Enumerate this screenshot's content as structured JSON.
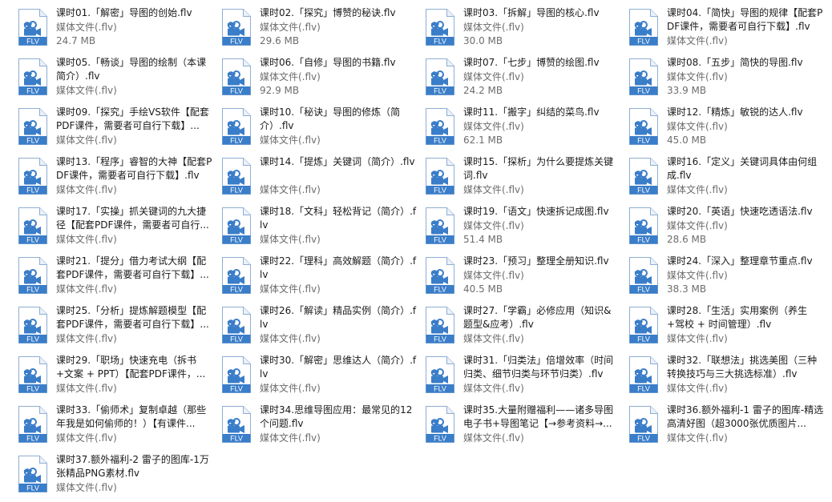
{
  "file_type_label": "媒体文件(.flv)",
  "icon_badge": "FLV",
  "icon_name": "video-camera-icon",
  "colors": {
    "icon_blue": "#3a7dc9",
    "icon_blue_dark": "#245f9e",
    "text": "#1a1a1a",
    "meta_text": "#6d6d6d"
  },
  "files": [
    {
      "name": "课时01.「解密」导图的创始.flv",
      "size": "24.7 MB"
    },
    {
      "name": "课时02.「探究」博赞的秘诀.flv",
      "size": "29.6 MB"
    },
    {
      "name": "课时03.「拆解」导图的核心.flv",
      "size": "30.0 MB"
    },
    {
      "name": "课时04.「简快」导图的规律【配套PDF课件，需要者可自行下载】.flv",
      "size": ""
    },
    {
      "name": "课时05.「畅谈」导图的绘制（本课简介）.flv",
      "size": ""
    },
    {
      "name": "课时06.「自修」导图的书籍.flv",
      "size": "92.9 MB"
    },
    {
      "name": "课时07.「七步」博赞的绘图.flv",
      "size": "24.2 MB"
    },
    {
      "name": "课时08.「五步」简快的导图.flv",
      "size": "33.9 MB"
    },
    {
      "name": "课时09.「探究」手绘VS软件【配套PDF课件，需要者可自行下载】...",
      "size": ""
    },
    {
      "name": "课时10.「秘诀」导图的修炼（简介）.flv",
      "size": ""
    },
    {
      "name": "课时11.「搬字」纠结的菜鸟.flv",
      "size": "62.1 MB"
    },
    {
      "name": "课时12.「精炼」敏锐的达人.flv",
      "size": "45.0 MB"
    },
    {
      "name": "课时13.「程序」睿智的大神【配套PDF课件，需要者可自行下载】.flv",
      "size": ""
    },
    {
      "name": "课时14.「提炼」关键词（简介）.flv",
      "size": ""
    },
    {
      "name": "课时15.「探析」为什么要提炼关键词.flv",
      "size": ""
    },
    {
      "name": "课时16.「定义」关键词具体由何组成.flv",
      "size": ""
    },
    {
      "name": "课时17.「实操」抓关键词的九大捷径【配套PDF课件，需要者可自行...",
      "size": ""
    },
    {
      "name": "课时18.「文科」轻松背记（简介）.flv",
      "size": ""
    },
    {
      "name": "课时19.「语文」快速拆记成图.flv",
      "size": "51.4 MB"
    },
    {
      "name": "课时20.「英语」快速吃透语法.flv",
      "size": "28.6 MB"
    },
    {
      "name": "课时21.「提分」借力考试大纲【配套PDF课件，需要者可自行下载】...",
      "size": ""
    },
    {
      "name": "课时22.「理科」高效解题（简介）.flv",
      "size": ""
    },
    {
      "name": "课时23.「预习」整理全册知识.flv",
      "size": "40.5 MB"
    },
    {
      "name": "课时24.「深入」整理章节重点.flv",
      "size": "38.3 MB"
    },
    {
      "name": "课时25.「分析」提炼解题模型【配套PDF课件，需要者可自行下载】...",
      "size": ""
    },
    {
      "name": "课时26.「解读」精品实例（简介）.flv",
      "size": ""
    },
    {
      "name": "课时27.「学霸」必修应用（知识&题型&应考）.flv",
      "size": ""
    },
    {
      "name": "课时28.「生活」实用案例（养生+驾校 + 时间管理）.flv",
      "size": ""
    },
    {
      "name": "课时29.「职场」快速充电（拆书+文案 + PPT）【配套PDF课件，...",
      "size": ""
    },
    {
      "name": "课时30.「解密」思维达人（简介）.flv",
      "size": ""
    },
    {
      "name": "课时31.「归类法」倍增效率（时间归类、细节归类与环节归类）.flv",
      "size": ""
    },
    {
      "name": "课时32.「联想法」挑选美图（三种转换技巧与三大挑选标准）.flv",
      "size": ""
    },
    {
      "name": "课时33.「偷师术」复制卓越（那些年我是如何偷师的！）【有课件...",
      "size": ""
    },
    {
      "name": "课时34.思维导图应用：最常见的12个问题.flv",
      "size": ""
    },
    {
      "name": "课时35.大量附赠福利——诸多导图电子书+导图笔记【→参考资料→...",
      "size": ""
    },
    {
      "name": "课时36.额外福利-1 雷子的图库-精选高清好图（超3000张优质图片...",
      "size": ""
    },
    {
      "name": "课时37.额外福利-2 雷子的图库-1万张精品PNG素材.flv",
      "size": ""
    }
  ]
}
